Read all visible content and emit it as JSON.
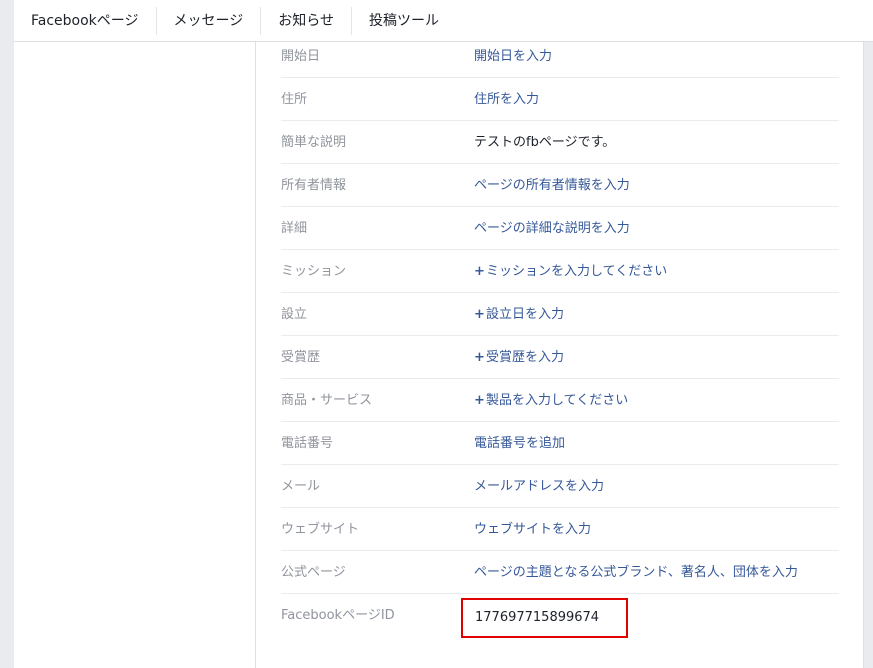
{
  "nav": {
    "tabs": [
      {
        "label": "Facebookページ"
      },
      {
        "label": "メッセージ"
      },
      {
        "label": "お知らせ"
      },
      {
        "label": "投稿ツール"
      }
    ]
  },
  "info": {
    "rows": [
      {
        "label": "開始日",
        "value": "開始日を入力"
      },
      {
        "label": "住所",
        "value": "住所を入力"
      },
      {
        "label": "簡単な説明",
        "value": "テストのfbページです。"
      },
      {
        "label": "所有者情報",
        "value": "ページの所有者情報を入力"
      },
      {
        "label": "詳細",
        "value": "ページの詳細な説明を入力"
      },
      {
        "label": "ミッション",
        "value": "ミッションを入力してください"
      },
      {
        "label": "設立",
        "value": "設立日を入力"
      },
      {
        "label": "受賞歴",
        "value": "受賞歴を入力"
      },
      {
        "label": "商品・サービス",
        "value": "製品を入力してください"
      },
      {
        "label": "電話番号",
        "value": "電話番号を追加"
      },
      {
        "label": "メール",
        "value": "メールアドレスを入力"
      },
      {
        "label": "ウェブサイト",
        "value": "ウェブサイトを入力"
      },
      {
        "label": "公式ページ",
        "value": "ページの主題となる公式ブランド、著名人、団体を入力"
      },
      {
        "label": "FacebookページID",
        "value": "177697715899674"
      }
    ],
    "plus_symbol": "+"
  },
  "colors": {
    "link": "#365899",
    "label": "#90949c",
    "highlight_border": "#e00000",
    "background": "#e9ebee"
  }
}
